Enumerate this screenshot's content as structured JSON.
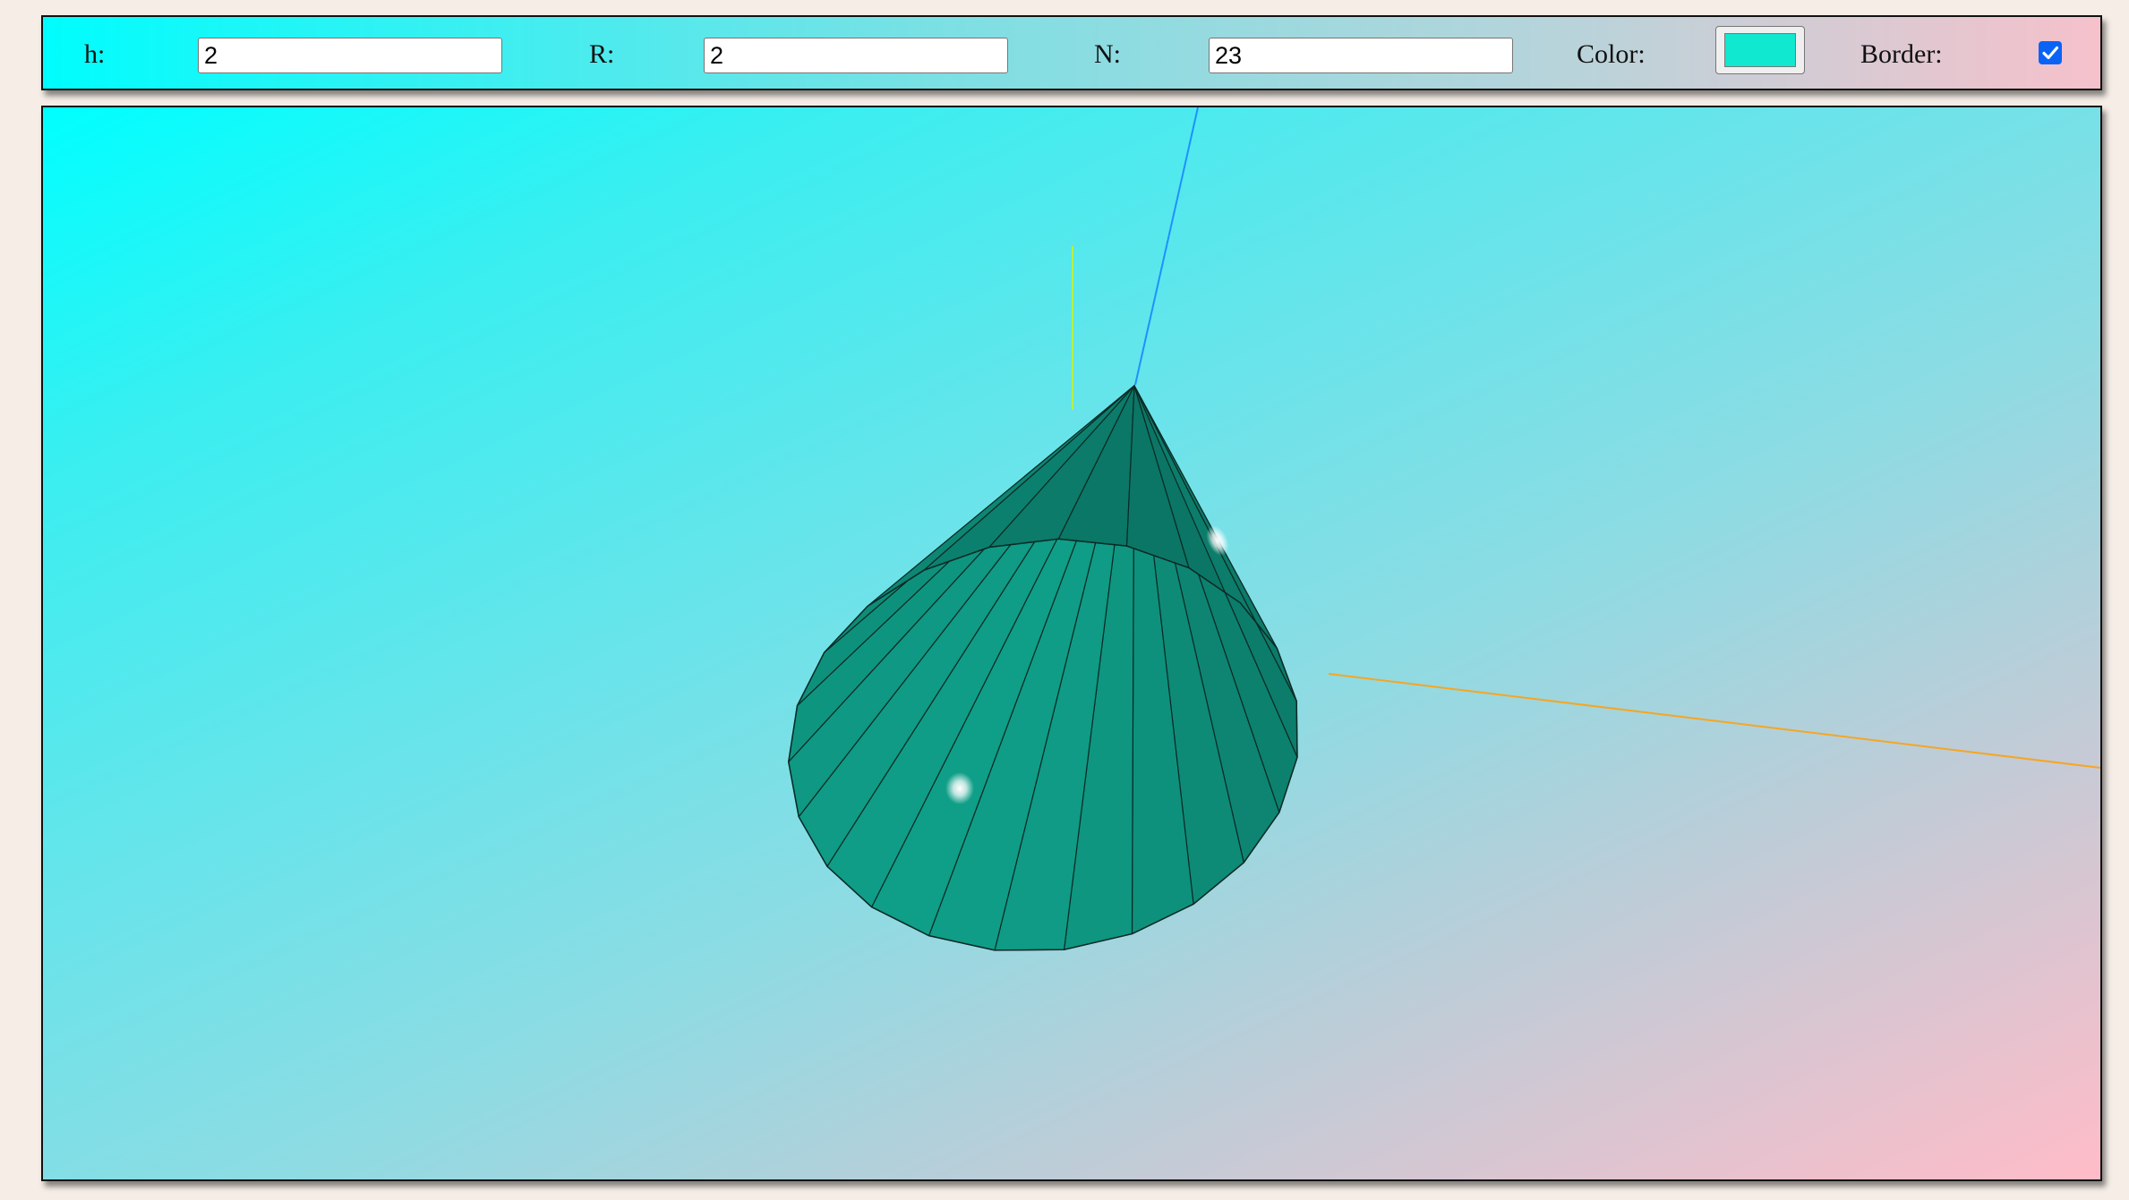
{
  "controls": {
    "h": {
      "label": "h:",
      "value": "2"
    },
    "r": {
      "label": "R:",
      "value": "2"
    },
    "n": {
      "label": "N:",
      "value": "23"
    },
    "color": {
      "label": "Color:",
      "value": "#10e8cf"
    },
    "border": {
      "label": "Border:",
      "checked": true
    }
  },
  "scene": {
    "shape": "cone",
    "segments": 23,
    "face_color": "#10a890",
    "edge_color": "#0a2a26",
    "axes": {
      "x_color": "#f5a623",
      "y_color": "#b4f04a",
      "z_color": "#1e90ff"
    }
  },
  "colors": {
    "toolbar_gradient": [
      "#00fdfd",
      "#f6c1cb"
    ],
    "viewport_gradient": [
      "#00ffff",
      "#ffbcc8"
    ],
    "checkbox_accent": "#0b63f6"
  }
}
